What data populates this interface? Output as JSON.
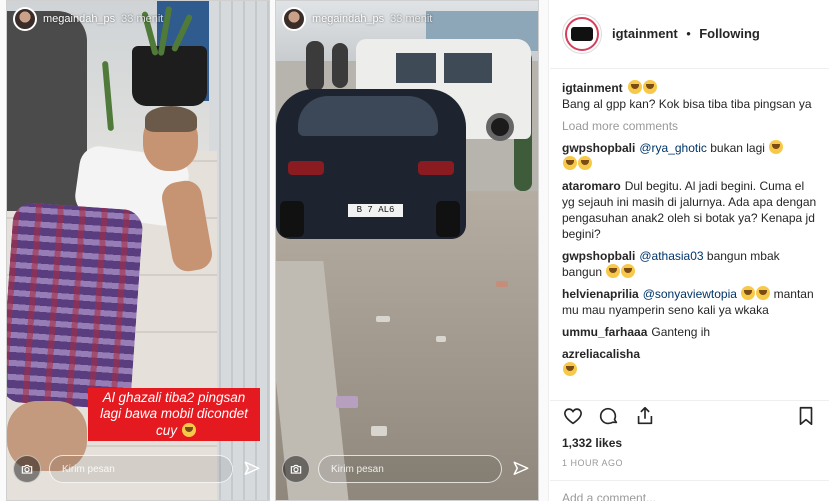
{
  "stories": [
    {
      "username": "megaindah_ps",
      "time": "33 menit",
      "caption_lines": [
        "Al ghazali tiba2 pingsan",
        "lagi bawa mobil dicondet",
        "cuy"
      ],
      "message_placeholder": "Kirim pesan"
    },
    {
      "username": "megaindah_ps",
      "time": "33 menit",
      "plate_text": "B 7 AL6",
      "message_placeholder": "Kirim pesan"
    }
  ],
  "post": {
    "username": "igtainment",
    "separator": "•",
    "follow_status": "Following",
    "caption": "Bang al gpp kan? Kok bisa tiba tiba pingsan ya",
    "load_more": "Load more comments",
    "comments": [
      {
        "user": "gwpshopbali",
        "mention": "@rya_ghotic",
        "text": " bukan lagi"
      },
      {
        "user": "ataromaro",
        "mention": "",
        "text": "Dul begitu. Al jadi begini. Cuma el yg sejauh ini masih di jalurnya. Ada apa dengan pengasuhan anak2 oleh si botak ya? Kenapa jd begini?"
      },
      {
        "user": "gwpshopbali",
        "mention": "@athasia03",
        "text": " bangun mbak bangun"
      },
      {
        "user": "helvienaprilia",
        "mention": "@sonyaviewtopia",
        "text": " mantan mu mau nyamperin seno kali ya wkaka"
      },
      {
        "user": "ummu_farhaaa",
        "mention": "",
        "text": "Ganteng ih"
      },
      {
        "user": "azreliacalisha",
        "mention": "",
        "text": ""
      }
    ],
    "likes": "1,332 likes",
    "time": "1 HOUR AGO",
    "add_comment_placeholder": "Add a comment..."
  },
  "icons": [
    "camera-icon",
    "send-icon",
    "heart-icon",
    "comment-icon",
    "share-icon",
    "bookmark-icon"
  ],
  "colors": {
    "caption_bg": "#e51920",
    "mention": "#003569",
    "muted": "#999999"
  }
}
